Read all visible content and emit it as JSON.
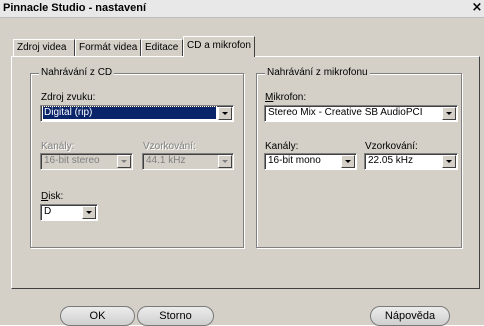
{
  "window": {
    "title": "Pinnacle Studio - nastavení",
    "close_glyph": "×"
  },
  "tabs": [
    {
      "label": "Zdroj videa"
    },
    {
      "label": "Formát videa"
    },
    {
      "label": "Editace"
    },
    {
      "label": "CD a mikrofon",
      "active": true
    }
  ],
  "cd_group": {
    "legend": "Nahrávání z CD",
    "source_label": "Zdroj zvuku:",
    "source_value": "Digital (rip)",
    "channels_label": "Kanály:",
    "channels_value": "16-bit stereo",
    "sampling_label": "Vzorkování:",
    "sampling_value": "44.1 kHz",
    "disk_label_first": "D",
    "disk_label_rest": "isk:",
    "disk_value": "D"
  },
  "mic_group": {
    "legend": "Nahrávání z mikrofonu",
    "mic_label_first": "M",
    "mic_label_rest": "ikrofon:",
    "mic_value": "Stereo Mix - Creative SB AudioPCI",
    "channels_label": "Kanály:",
    "channels_value": "16-bit mono",
    "sampling_label": "Vzorkování:",
    "sampling_value": "22.05 kHz"
  },
  "buttons": {
    "ok": "OK",
    "cancel": "Storno",
    "help": "Nápověda"
  }
}
